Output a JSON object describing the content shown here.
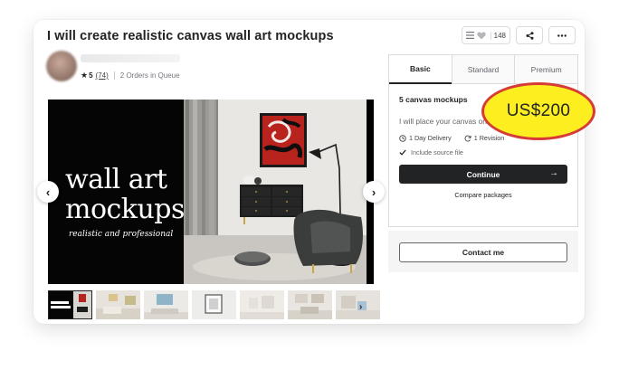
{
  "gig": {
    "title": "I will create realistic canvas wall art mockups",
    "like_count": "148"
  },
  "seller": {
    "rating": "5",
    "reviews": "(74)",
    "queue": "2 Orders in Queue"
  },
  "gallery": {
    "hero_line_1": "wall art",
    "hero_line_2": "mockups",
    "hero_subtitle": "realistic and professional",
    "thumbnail_count": 7
  },
  "package": {
    "tabs": [
      "Basic",
      "Standard",
      "Premium"
    ],
    "active_tab": "Basic",
    "name": "5 canvas mockups",
    "description": "I will place your canvas on walls.",
    "delivery": "1 Day Delivery",
    "revisions": "1 Revision",
    "include": "Include source file",
    "continue_label": "Continue",
    "compare_label": "Compare packages"
  },
  "contact": {
    "label": "Contact me"
  },
  "price_badge": "US$200",
  "colors": {
    "primary_dark": "#222325",
    "badge_fill": "#fcee1f",
    "badge_border": "#d73b36",
    "border": "#dadbdd"
  }
}
